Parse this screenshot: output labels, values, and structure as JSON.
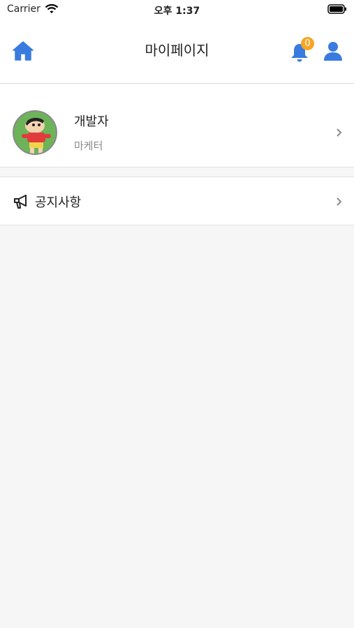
{
  "status_bar": {
    "carrier": "Carrier",
    "time": "오후 1:37"
  },
  "header": {
    "title": "마이페이지",
    "notification_count": "0"
  },
  "profile": {
    "name": "개발자",
    "role": "마케터"
  },
  "menu": {
    "notice_label": "공지사항"
  },
  "icons": {
    "home": "home-icon",
    "bell": "bell-icon",
    "user": "user-icon",
    "megaphone": "megaphone-icon",
    "chevron": "chevron-right-icon",
    "wifi": "wifi-icon",
    "battery": "battery-icon"
  },
  "colors": {
    "accent": "#3a7be0",
    "badge": "#f5a623",
    "background": "#f6f6f6",
    "avatar_bg": "#6db35a"
  }
}
